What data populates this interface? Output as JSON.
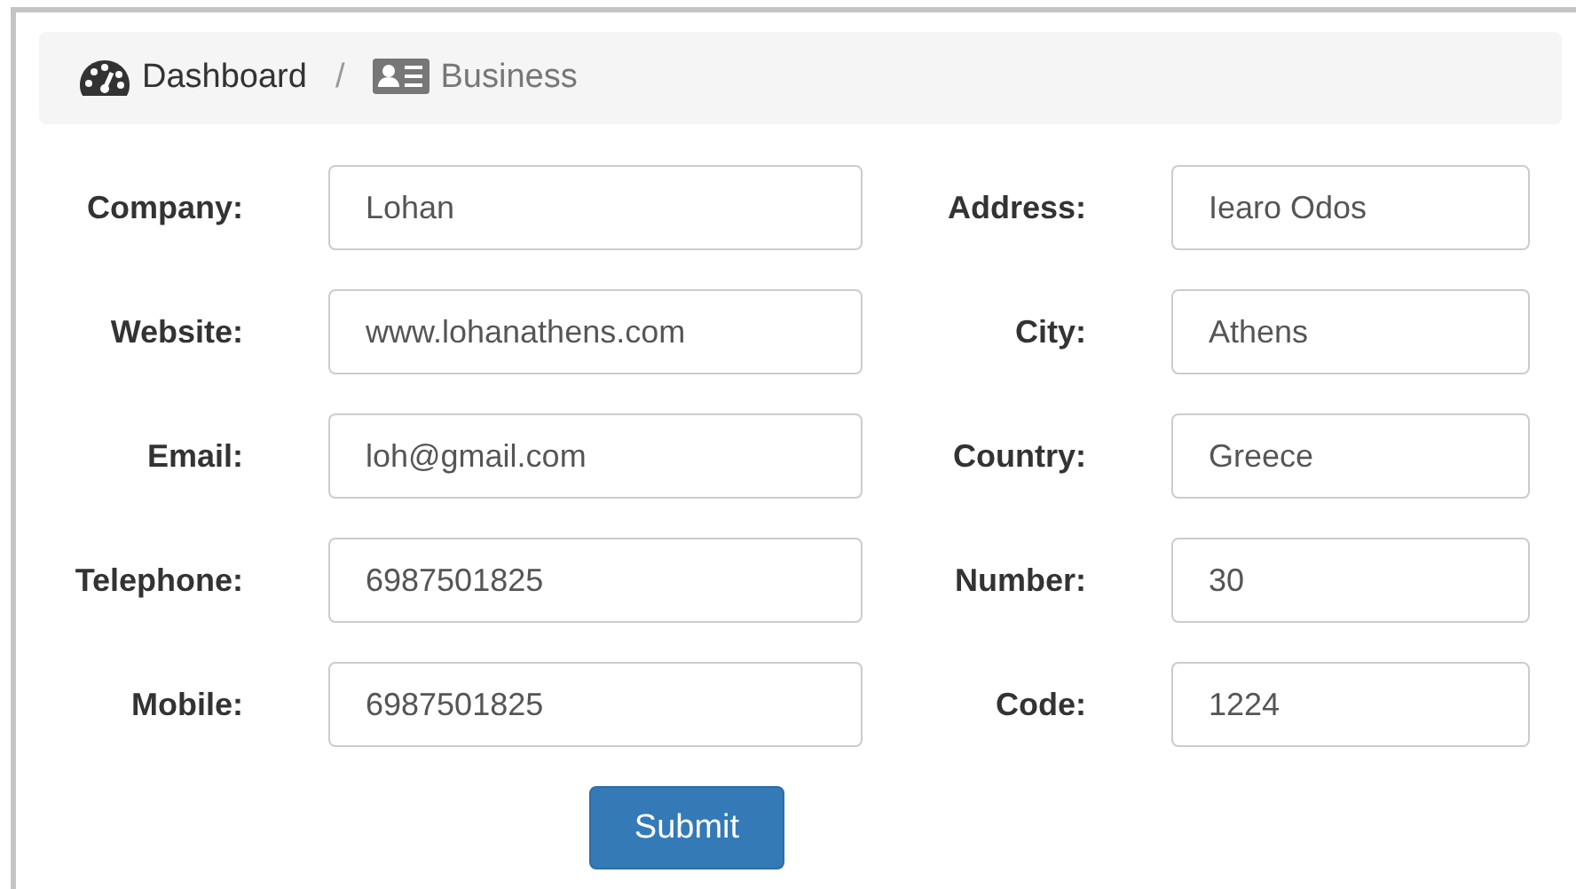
{
  "breadcrumb": [
    {
      "label": "Dashboard",
      "selected": false
    },
    {
      "label": "Business",
      "selected": true
    }
  ],
  "breadcrumb_separator": "/",
  "fields": [
    {
      "label": "Company:",
      "value": "Lohan"
    },
    {
      "label": "Address:",
      "value": "Iearo Odos"
    },
    {
      "label": "Website:",
      "value": "www.lohanathens.com"
    },
    {
      "label": "City:",
      "value": "Athens"
    },
    {
      "label": "Email:",
      "value": "loh@gmail.com"
    },
    {
      "label": "Country:",
      "value": "Greece"
    },
    {
      "label": "Telephone:",
      "value": "6987501825"
    },
    {
      "label": "Number:",
      "value": "30"
    },
    {
      "label": "Mobile:",
      "value": "6987501825"
    },
    {
      "label": "Code:",
      "value": "1224"
    }
  ],
  "submit": "Submit"
}
